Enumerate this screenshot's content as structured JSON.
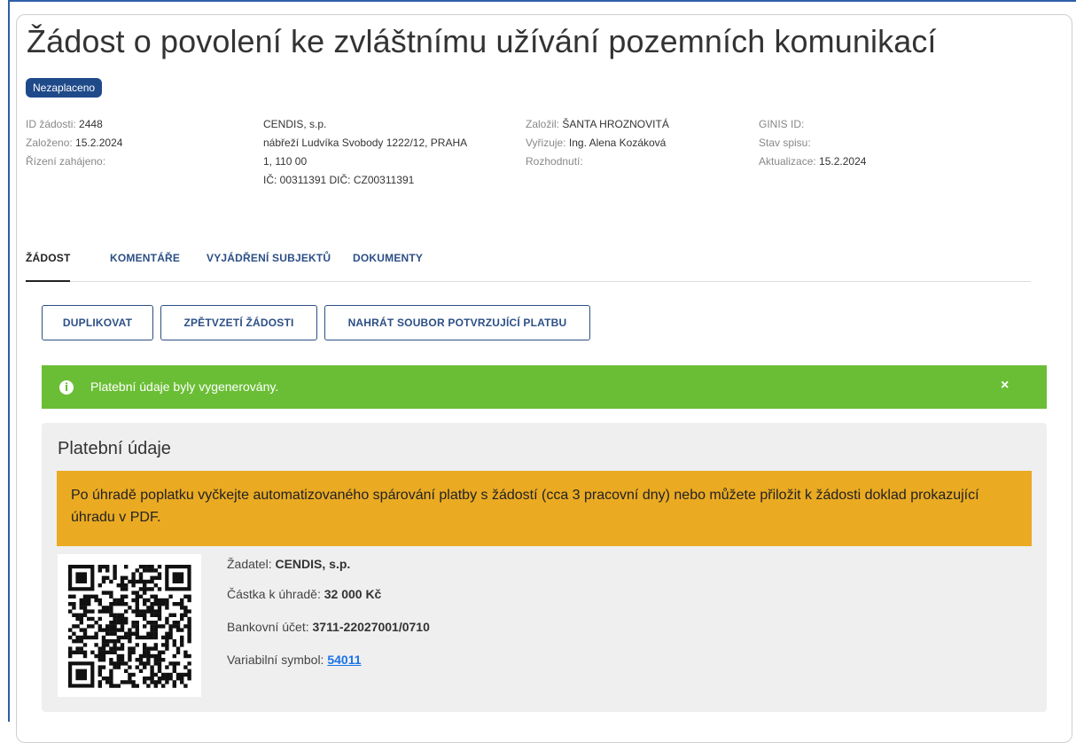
{
  "page": {
    "title": "Žádost o povolení ke zvláštnímu užívání pozemních komunikací",
    "status_badge": "Nezaplaceno"
  },
  "meta": {
    "col1": [
      {
        "label": "ID žádosti:",
        "value": "2448"
      },
      {
        "label": "Založeno:",
        "value": "15.2.2024"
      },
      {
        "label": "Řízení zahájeno:",
        "value": ""
      }
    ],
    "col2": [
      "CENDIS, s.p.",
      "nábřeží Ludvíka Svobody 1222/12, PRAHA",
      "1, 110 00",
      "IČ: 00311391 DIČ: CZ00311391"
    ],
    "col3": [
      {
        "label": "Založil:",
        "value": "ŠANTA HROZNOVITÁ"
      },
      {
        "label": "Vyřizuje:",
        "value": "Ing. Alena Kozáková"
      },
      {
        "label": "Rozhodnutí:",
        "value": ""
      }
    ],
    "col4": [
      {
        "label": "GINIS ID:",
        "value": ""
      },
      {
        "label": "Stav spisu:",
        "value": ""
      },
      {
        "label": "Aktualizace:",
        "value": "15.2.2024"
      }
    ]
  },
  "tabs": [
    {
      "label": "ŽÁDOST",
      "active": true
    },
    {
      "label": "KOMENTÁŘE",
      "active": false
    },
    {
      "label": "VYJÁDŘENÍ SUBJEKTŮ",
      "active": false
    },
    {
      "label": "DOKUMENTY",
      "active": false
    }
  ],
  "actions": {
    "duplicate": "DUPLIKOVAT",
    "withdraw": "ZPĚTVZETÍ ŽÁDOSTI",
    "upload_payment": "NAHRÁT SOUBOR POTVRZUJÍCÍ PLATBU"
  },
  "alert": {
    "icon": "info-icon",
    "text": "Platební údaje byly vygenerovány.",
    "close": "×",
    "color": "#6abe35"
  },
  "payment": {
    "title": "Platební údaje",
    "warning": "Po úhradě poplatku vyčkejte automatizovaného spárování platby s žádostí (cca 3 pracovní dny) nebo můžete přiložit k žádosti doklad prokazující úhradu v PDF.",
    "warning_color": "#eaaa22",
    "applicant_label": "Žadatel:",
    "applicant_value": "CENDIS, s.p.",
    "amount_label": "Částka k úhradě:",
    "amount_value": "32 000 Kč",
    "account_label": "Bankovní účet:",
    "account_value": "3711-22027001/0710",
    "vs_label": "Variabilní symbol:",
    "vs_value": "54011"
  },
  "colors": {
    "primary": "#2c4f86",
    "badge": "#1f4a8a"
  }
}
